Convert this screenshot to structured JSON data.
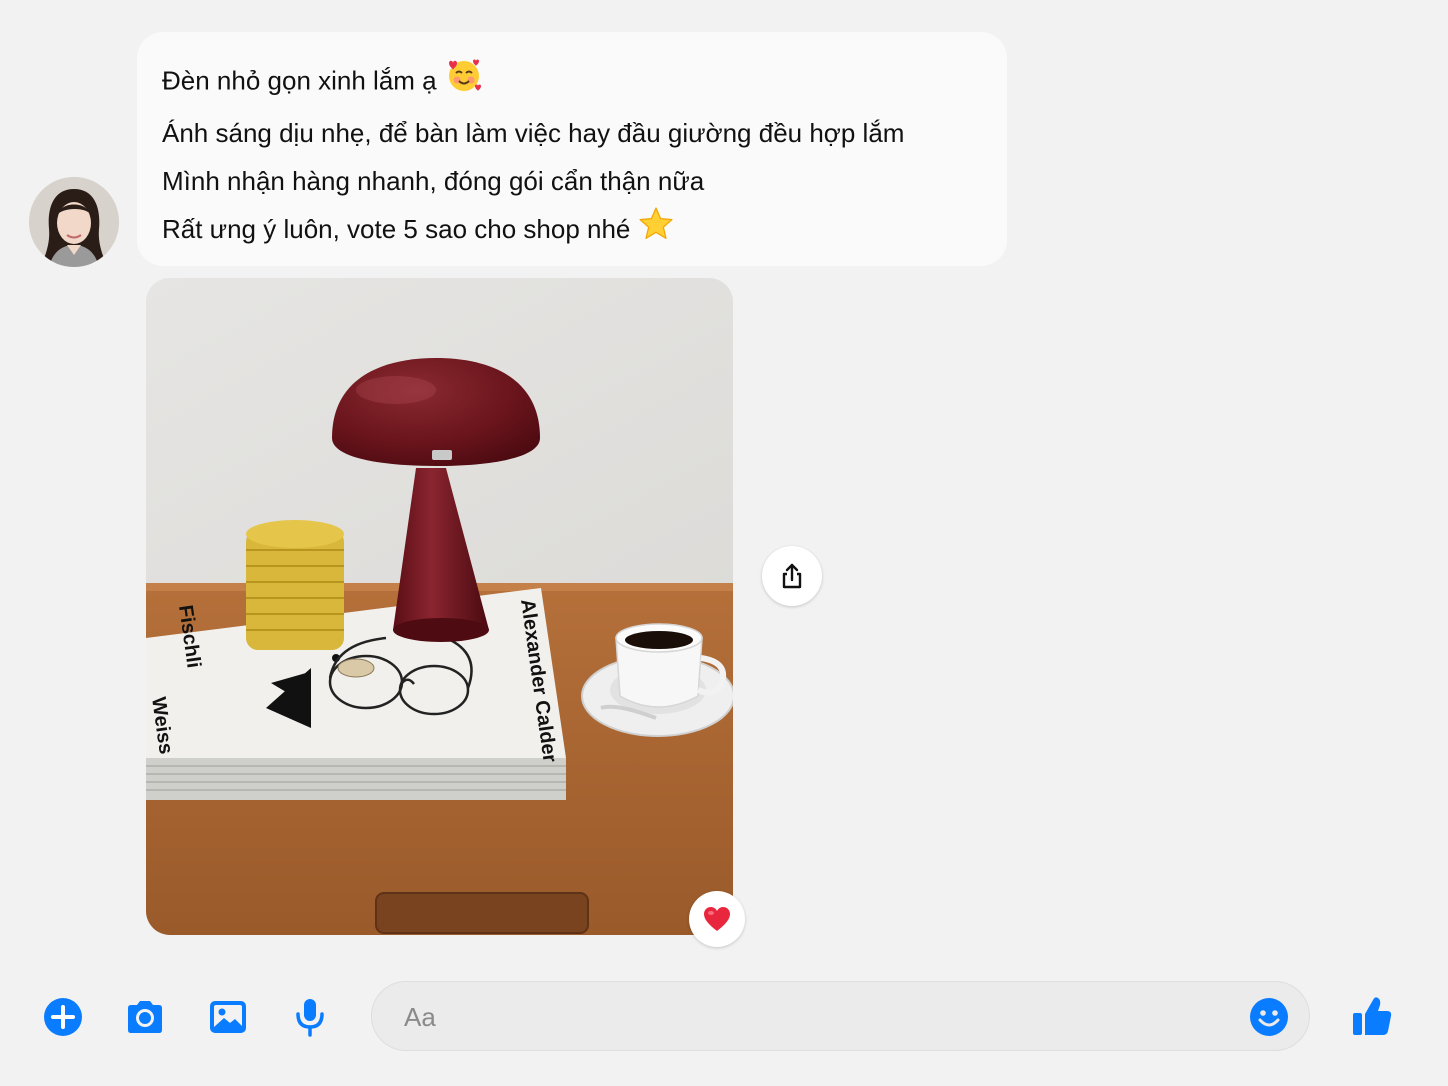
{
  "conversation": {
    "messages": [
      {
        "line": "Đèn nhỏ gọn xinh lắm ạ",
        "emoji": "smiling-face-with-hearts-icon"
      },
      {
        "line": "Ánh sáng dịu nhẹ, để bàn làm việc hay đầu giường đều hợp lắm"
      },
      {
        "line": "Mình nhận hàng nhanh, đóng gói cẩn thận nữa"
      },
      {
        "line": "Rất ưng ý luôn, vote 5 sao cho shop nhé",
        "emoji": "star-icon"
      }
    ],
    "photo": {
      "book_title": "Alexander Calder",
      "book_side_text": "Fischli",
      "book_side_text_2": "Weiss"
    },
    "reaction": "heart-icon"
  },
  "composer": {
    "placeholder": "Aa",
    "value": ""
  },
  "colors": {
    "accent": "#0a7cff",
    "background": "#f2f2f2",
    "bubble": "#fafafa"
  }
}
